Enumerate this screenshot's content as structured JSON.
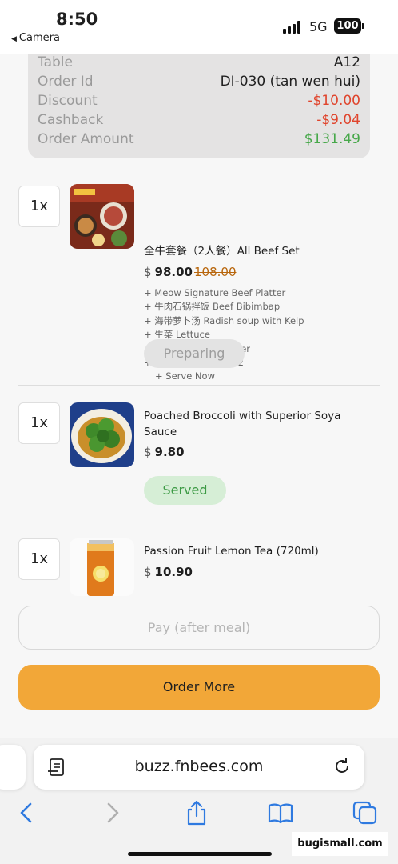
{
  "status_bar": {
    "time": "8:50",
    "back_app": "Camera",
    "network": "5G",
    "battery": "100"
  },
  "summary": {
    "rows": [
      {
        "label": "Table",
        "value": "A12",
        "tone": "default"
      },
      {
        "label": "Order Id",
        "value": "DI-030 (tan wen hui)",
        "tone": "default"
      },
      {
        "label": "Discount",
        "value": "-$10.00",
        "tone": "negative"
      },
      {
        "label": "Cashback",
        "value": "-$9.04",
        "tone": "negative"
      },
      {
        "label": "Order Amount",
        "value": "$131.49",
        "tone": "positive"
      }
    ]
  },
  "items": [
    {
      "qty": "1x",
      "name": "全牛套餐（2人餐）All Beef Set",
      "currency": "$",
      "price": "98.00",
      "old_price": "108.00",
      "modifiers": [
        "+ Meow Signature Beef Platter",
        "+ 牛肉石锅拌饭 Beef Bibimbap",
        "+ 海带萝卜汤 Radish soup with Kelp",
        "+ 生菜 Lettuce",
        "+ 蔬菜乐园 Vege Platter",
        "+ 冰淇淋 Ice cream×2",
        "+ Serve Now"
      ],
      "status": "Preparing"
    },
    {
      "qty": "1x",
      "name": "Poached Broccoli with Superior Soya Sauce",
      "currency": "$",
      "price": "9.80",
      "status": "Served"
    },
    {
      "qty": "1x",
      "name": "Passion Fruit Lemon Tea (720ml)",
      "currency": "$",
      "price": "10.90"
    }
  ],
  "buttons": {
    "pay": "Pay (after meal)",
    "order_more": "Order More"
  },
  "browser": {
    "url": "buzz.fnbees.com"
  },
  "watermark": "bugismall.com",
  "colors": {
    "accent": "#f2a738",
    "negative": "#e0452d",
    "positive": "#47a84a",
    "served_bg": "#d6eed6"
  }
}
